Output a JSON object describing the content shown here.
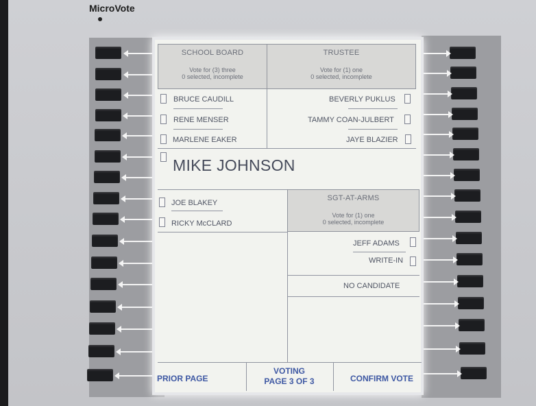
{
  "device": {
    "brand": "MicroVote"
  },
  "ballot": {
    "school_board": {
      "title": "SCHOOL BOARD",
      "vote_for": "Vote for (3) three",
      "status": "0 selected, incomplete",
      "candidates": [
        "BRUCE CAUDILL",
        "RENE MENSER",
        "MARLENE EAKER",
        "MIKE JOHNSON",
        "JOE BLAKEY",
        "RICKY McCLARD"
      ]
    },
    "trustee": {
      "title": "TRUSTEE",
      "vote_for": "Vote for (1) one",
      "status": "0 selected, incomplete",
      "candidates": [
        "BEVERLY PUKLUS",
        "TAMMY COAN-JULBERT",
        "JAYE BLAZIER"
      ]
    },
    "sgt_at_arms": {
      "title": "SGT-AT-ARMS",
      "vote_for": "Vote for (1) one",
      "status": "0 selected, incomplete",
      "candidates": [
        "JEFF ADAMS",
        "WRITE-IN",
        "NO CANDIDATE"
      ]
    }
  },
  "footer": {
    "prior": "PRIOR PAGE",
    "voting": "VOTING",
    "page": "PAGE 3 OF 3",
    "confirm": "CONFIRM VOTE"
  }
}
